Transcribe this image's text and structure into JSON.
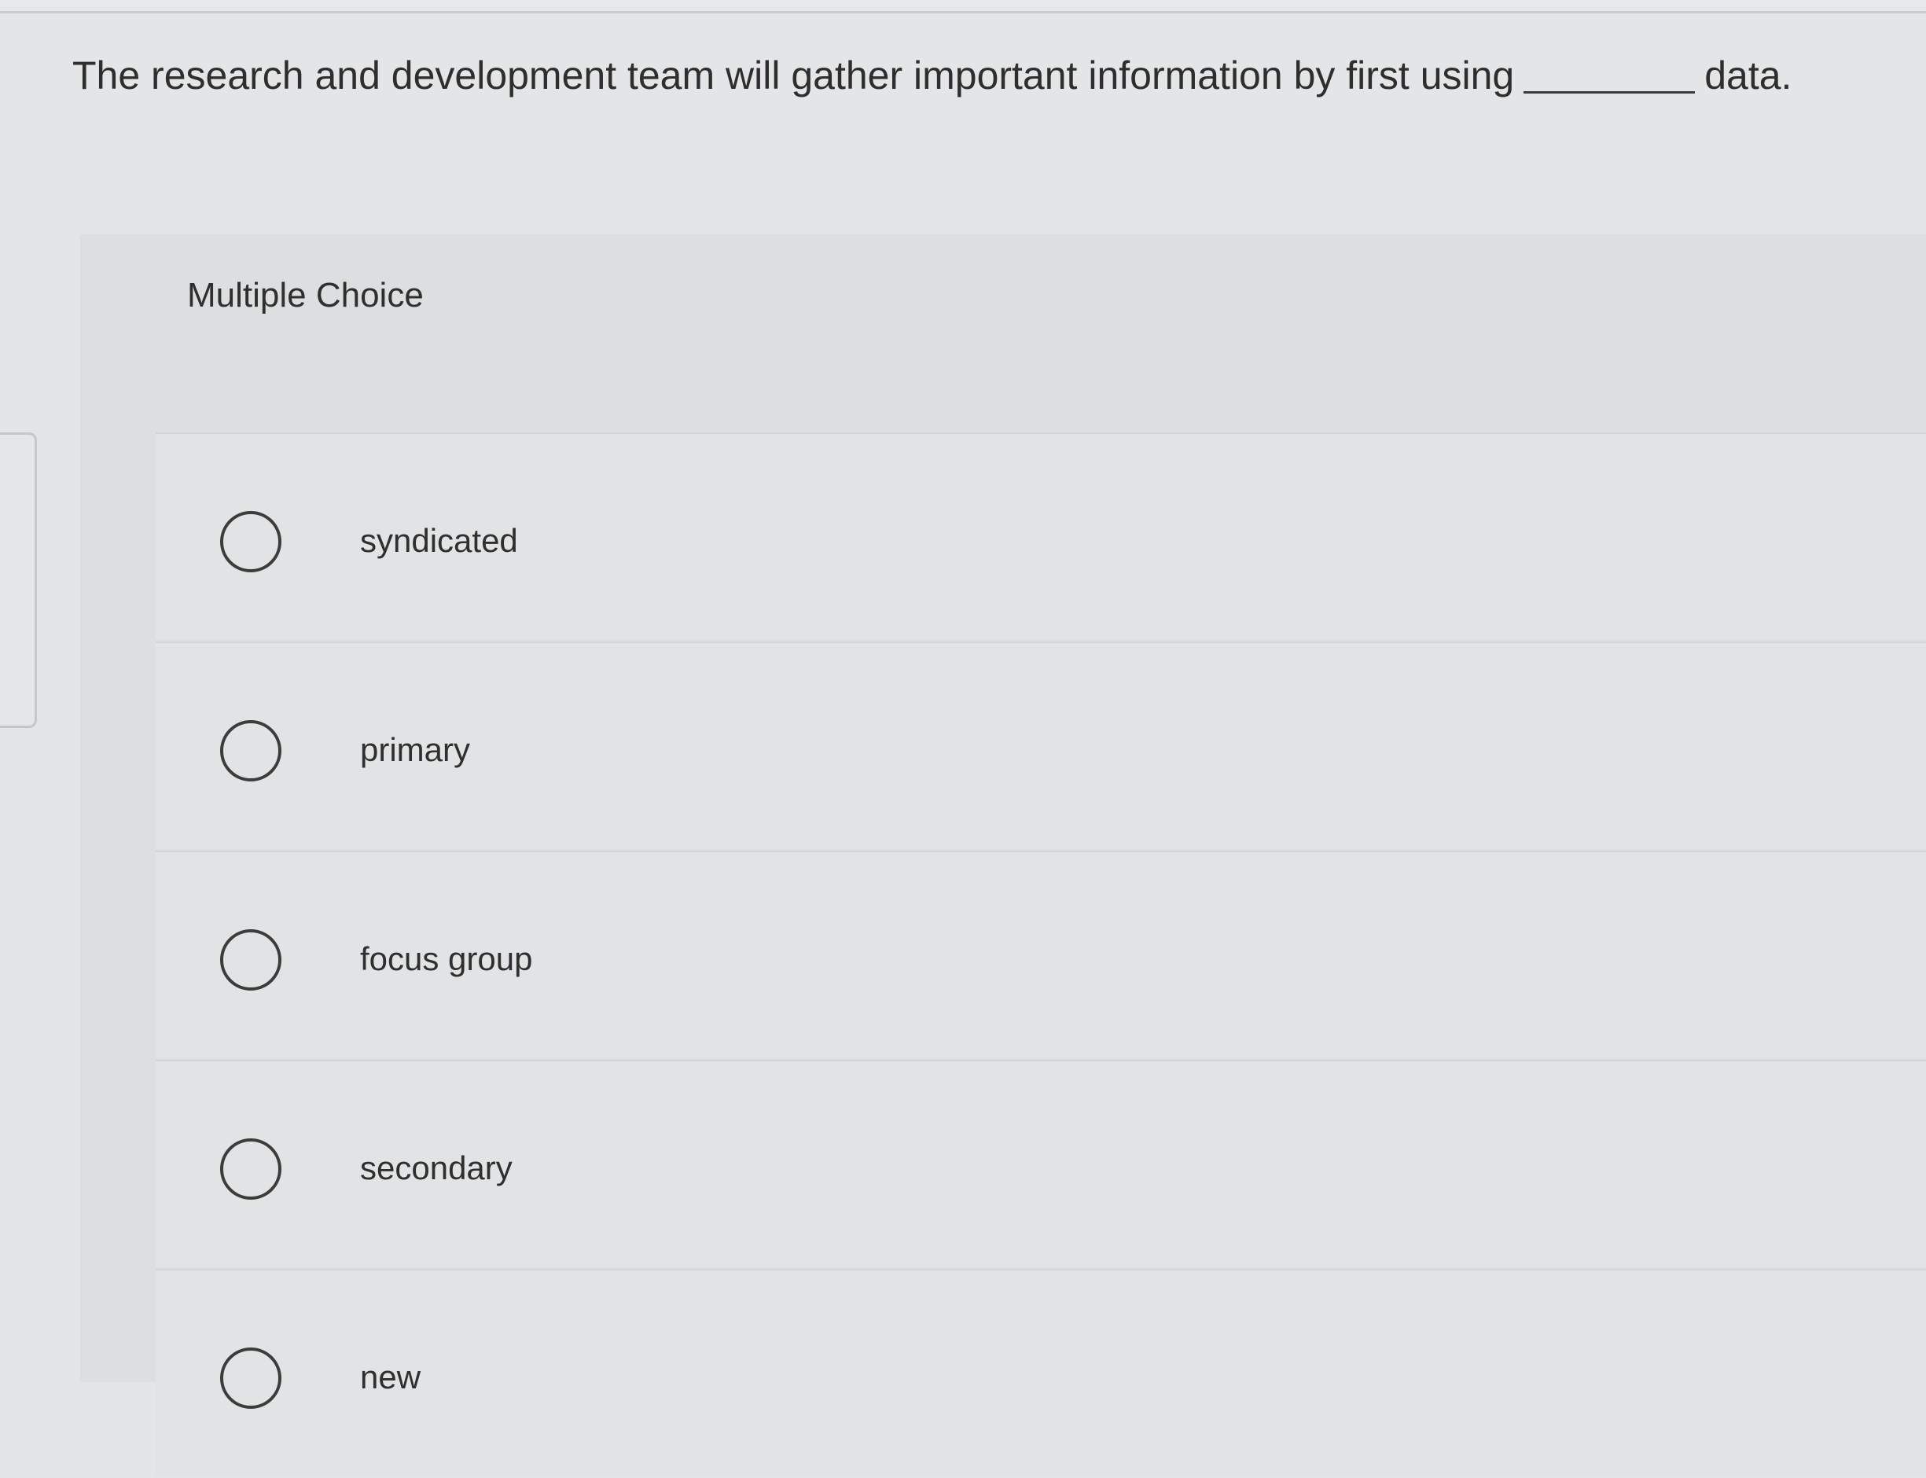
{
  "question": {
    "text_before": "The research and development team will gather important information by first using",
    "text_after": "data."
  },
  "quiz": {
    "type_label": "Multiple Choice",
    "options": [
      {
        "label": "syndicated"
      },
      {
        "label": "primary"
      },
      {
        "label": "focus group"
      },
      {
        "label": "secondary"
      },
      {
        "label": "new"
      }
    ]
  },
  "icons": {
    "radio": "radio-unchecked-icon"
  }
}
